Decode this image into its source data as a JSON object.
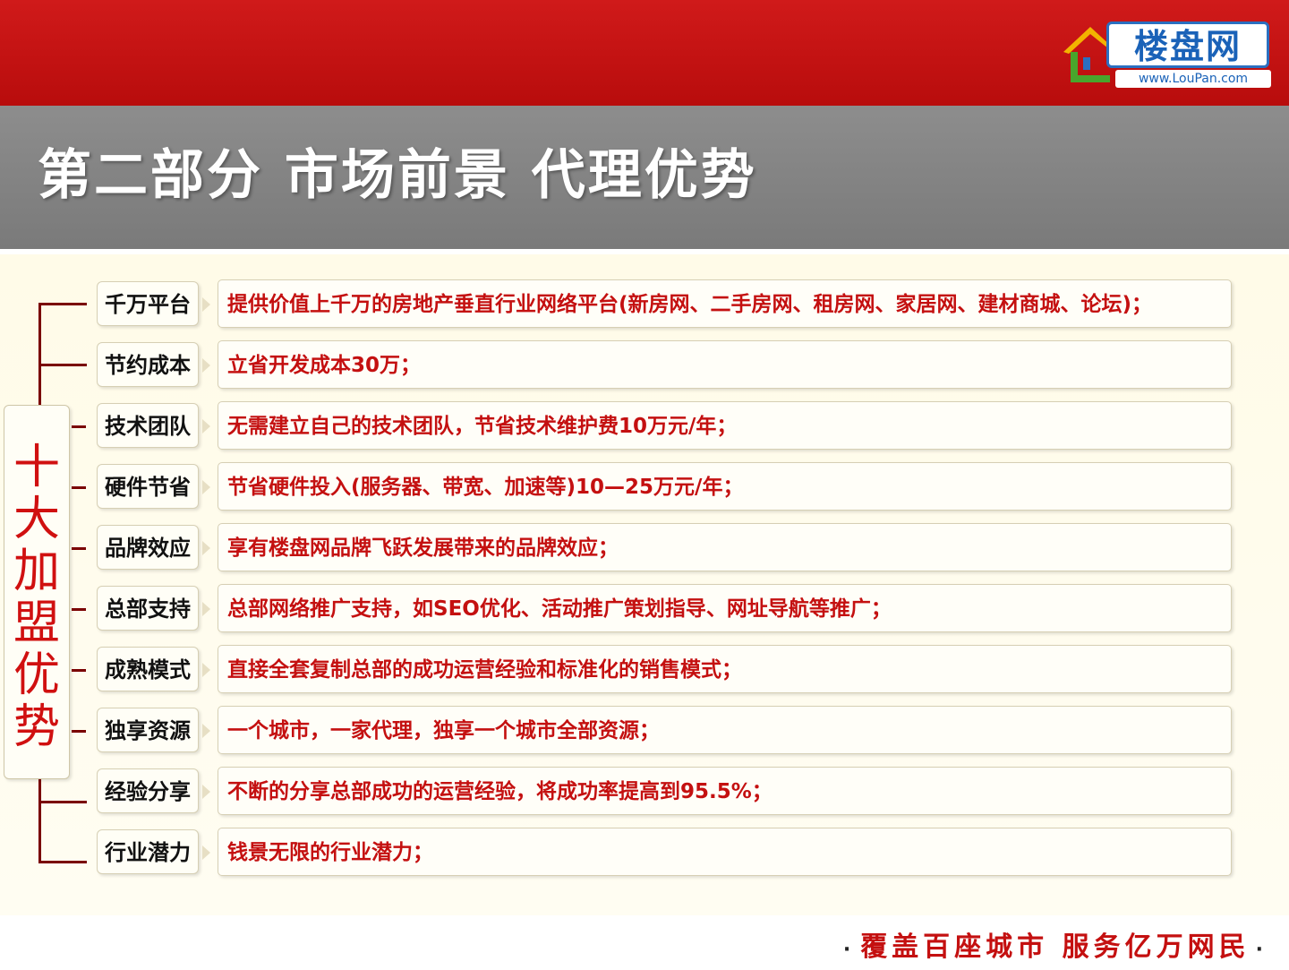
{
  "header": {
    "logo_text": "楼盘网",
    "logo_url": "www.LouPan.com",
    "title": "第二部分 市场前景 代理优势"
  },
  "colors": {
    "header_red": "#c41212",
    "title_band_gray": "#808080",
    "content_bg": "#fffbe8",
    "text_red": "#c41010",
    "tree_line": "#7a0000"
  },
  "main": {
    "vertical_label": "十大加盟优势",
    "items": [
      {
        "label": "千万平台",
        "text": "提供价值上千万的房地产垂直行业网络平台(新房网、二手房网、租房网、家居网、建材商城、论坛)；"
      },
      {
        "label": "节约成本",
        "text": "立省开发成本30万；"
      },
      {
        "label": "技术团队",
        "text": "无需建立自己的技术团队，节省技术维护费10万元/年；"
      },
      {
        "label": "硬件节省",
        "text": "节省硬件投入(服务器、带宽、加速等)10—25万元/年；"
      },
      {
        "label": "品牌效应",
        "text": "享有楼盘网品牌飞跃发展带来的品牌效应；"
      },
      {
        "label": "总部支持",
        "text": "总部网络推广支持，如SEO优化、活动推广策划指导、网址导航等推广；"
      },
      {
        "label": "成熟模式",
        "text": "直接全套复制总部的成功运营经验和标准化的销售模式；"
      },
      {
        "label": "独享资源",
        "text": "一个城市，一家代理，独享一个城市全部资源；"
      },
      {
        "label": "经验分享",
        "text": "不断的分享总部成功的运营经验，将成功率提高到95.5%；"
      },
      {
        "label": "行业潜力",
        "text": "钱景无限的行业潜力；"
      }
    ]
  },
  "footer": {
    "slogan": "覆盖百座城市 服务亿万网民"
  }
}
